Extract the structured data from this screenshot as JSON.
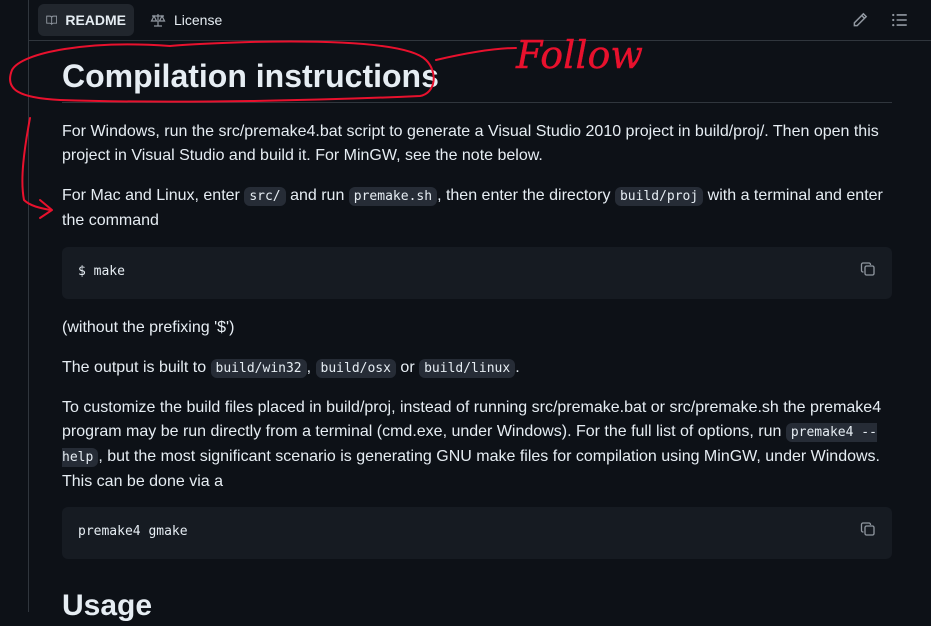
{
  "tabs": [
    {
      "label": "README",
      "icon": "book-icon",
      "active": true
    },
    {
      "label": "License",
      "icon": "law-icon",
      "active": false
    }
  ],
  "toolbar": {
    "edit_icon": "pencil-icon",
    "outline_icon": "list-icon"
  },
  "heading": "Compilation instructions",
  "paragraphs": {
    "p1": "For Windows, run the src/premake4.bat script to generate a Visual Studio 2010 project in build/proj/. Then open this project in Visual Studio and build it. For MinGW, see the note below.",
    "p2_a": "For Mac and Linux, enter ",
    "p2_code1": "src/",
    "p2_b": " and run ",
    "p2_code2": "premake.sh",
    "p2_c": ", then enter the directory ",
    "p2_code3": "build/proj",
    "p2_d": " with a terminal and enter the command",
    "p3": "(without the prefixing '$')",
    "p4_a": "The output is built to ",
    "p4_code1": "build/win32",
    "p4_b": ", ",
    "p4_code2": "build/osx",
    "p4_c": " or ",
    "p4_code3": "build/linux",
    "p4_d": ".",
    "p5_a": "To customize the build files placed in build/proj, instead of running src/premake.bat or src/premake.sh the premake4 program may be run directly from a terminal (cmd.exe, under Windows). For the full list of options, run ",
    "p5_code1": "premake4 --help",
    "p5_b": ", but the most significant scenario is generating GNU make files for compilation using MinGW, under Windows. This can be done via a"
  },
  "code_blocks": [
    "$ make",
    "premake4 gmake"
  ],
  "next_heading": "Usage",
  "annotation": {
    "text": "Follow",
    "color": "#e8112d"
  }
}
